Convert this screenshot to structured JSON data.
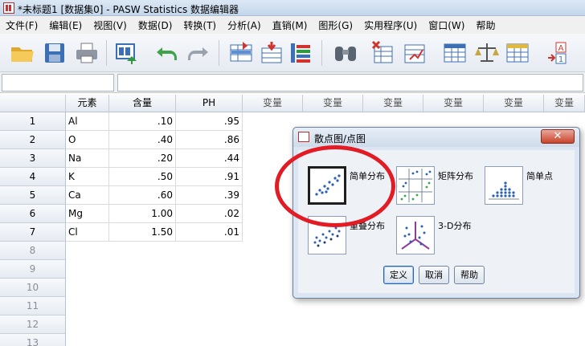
{
  "window": {
    "title": "*未标题1 [数据集0] - PASW Statistics 数据编辑器"
  },
  "menu": [
    "文件(F)",
    "编辑(E)",
    "视图(V)",
    "数据(D)",
    "转换(T)",
    "分析(A)",
    "直销(M)",
    "图形(G)",
    "实用程序(U)",
    "窗口(W)",
    "帮助"
  ],
  "columns": [
    "元素",
    "含量",
    "PH",
    "变量",
    "变量",
    "变量",
    "变量",
    "变量",
    "变量"
  ],
  "rows": [
    {
      "n": "1",
      "element": "Al",
      "content": ".10",
      "ph": ".95"
    },
    {
      "n": "2",
      "element": "O",
      "content": ".40",
      "ph": ".86"
    },
    {
      "n": "3",
      "element": "Na",
      "content": ".20",
      "ph": ".44"
    },
    {
      "n": "4",
      "element": "K",
      "content": ".50",
      "ph": ".91"
    },
    {
      "n": "5",
      "element": "Ca",
      "content": ".60",
      "ph": ".39"
    },
    {
      "n": "6",
      "element": "Mg",
      "content": "1.00",
      "ph": ".02"
    },
    {
      "n": "7",
      "element": "Cl",
      "content": "1.50",
      "ph": ".01"
    }
  ],
  "empty_rows": [
    "8",
    "9",
    "10",
    "11",
    "12",
    "13"
  ],
  "dialog": {
    "title": "散点图/点图",
    "options": [
      "简单分布",
      "矩阵分布",
      "简单点",
      "重叠分布",
      "3-D分布"
    ],
    "buttons": {
      "ok": "定义",
      "cancel": "取消",
      "help": "帮助"
    }
  },
  "colors": {
    "highlight_circle": "#e21b24",
    "dot": "#2a5fb8"
  },
  "icons": [
    "open-folder-icon",
    "save-icon",
    "print-icon",
    "dialog-recall-icon",
    "undo-icon",
    "redo-icon",
    "goto-case-icon",
    "goto-variable-icon",
    "variables-icon",
    "find-icon",
    "insert-cases-icon",
    "insert-variable-icon",
    "split-file-icon",
    "weight-cases-icon",
    "select-cases-icon",
    "value-labels-icon"
  ]
}
